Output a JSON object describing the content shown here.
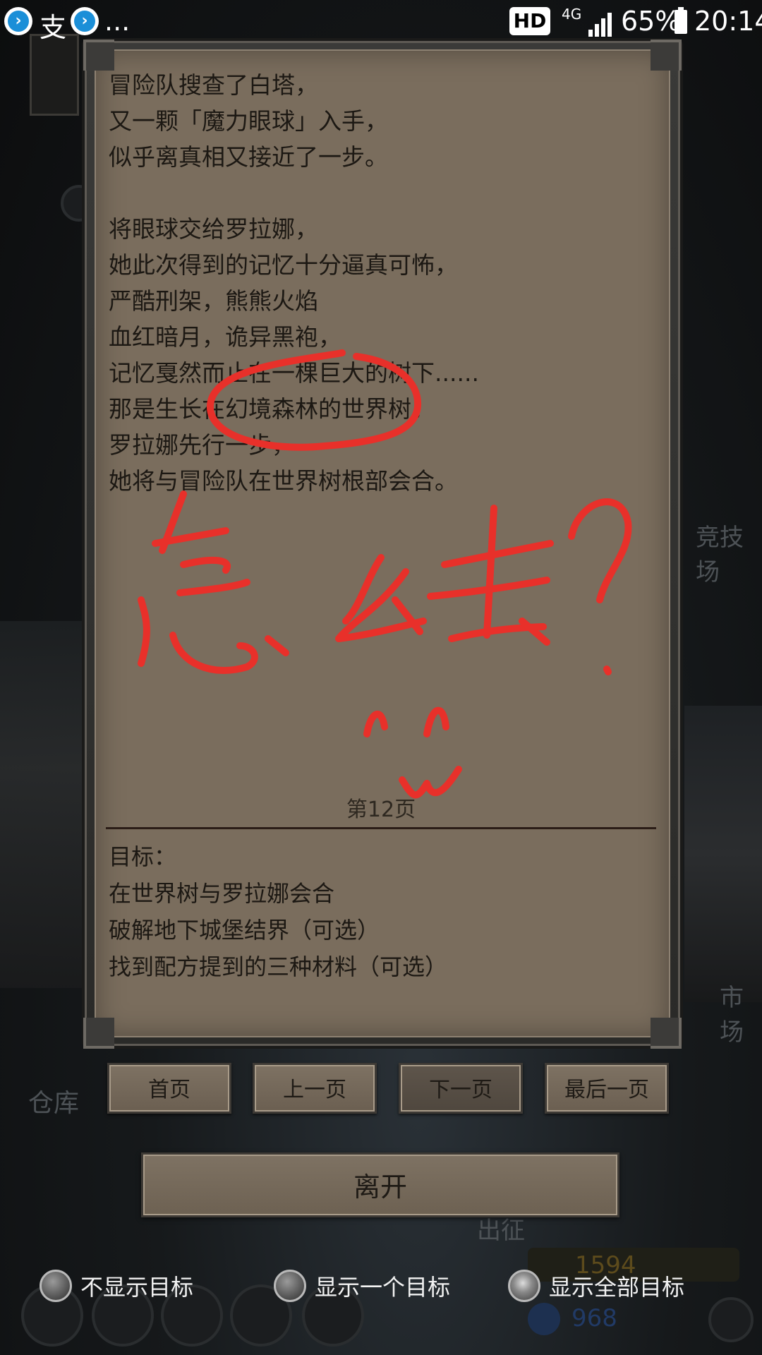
{
  "status_bar": {
    "notif_text_1": "支",
    "notif_more": "...",
    "hd_badge": "HD",
    "network": "4G",
    "battery_percent": "65%",
    "time": "20:14"
  },
  "background": {
    "left_label": "仓库",
    "right_label_top": "竞技场",
    "right_label_mid": "市场",
    "center_label": "出征",
    "coins": "1594",
    "gems": "968"
  },
  "story": {
    "lines": [
      "冒险队搜查了白塔，",
      "又一颗「魔力眼球」入手，",
      "似乎离真相又接近了一步。",
      "",
      "将眼球交给罗拉娜，",
      "她此次得到的记忆十分逼真可怖，",
      "严酷刑架，熊熊火焰",
      "血红暗月，诡异黑袍，",
      "记忆戛然而止在一棵巨大的树下......",
      "那是生长在幻境森林的世界树。",
      "罗拉娜先行一步，",
      "她将与冒险队在世界树根部会合。"
    ],
    "page_label": "第12页"
  },
  "goals": {
    "title": "目标：",
    "items": [
      "在世界树与罗拉娜会合",
      "破解地下城堡结界（可选）",
      "找到配方提到的三种材料（可选）"
    ]
  },
  "nav": {
    "first": "首页",
    "prev": "上一页",
    "next": "下一页",
    "last": "最后一页"
  },
  "leave_label": "离开",
  "options": {
    "hide_goals": "不显示目标",
    "show_one": "显示一个目标",
    "show_all": "显示全部目标"
  },
  "annotation": {
    "color": "#e8302a"
  }
}
